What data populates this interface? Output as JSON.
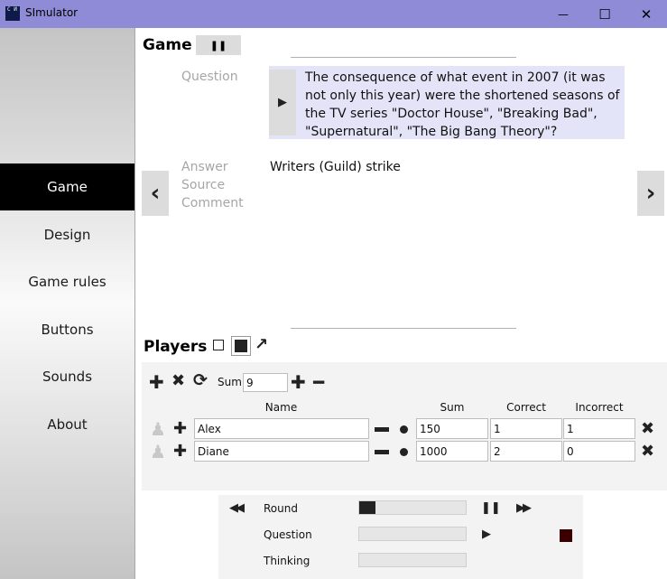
{
  "window": {
    "title": "SImulator",
    "app_icon_glyph": "С И",
    "minimize_glyph": "—",
    "maximize_glyph": "☐",
    "close_glyph": "✕"
  },
  "sidebar": {
    "items": [
      {
        "label": "Game",
        "active": true
      },
      {
        "label": "Design",
        "active": false
      },
      {
        "label": "Game rules",
        "active": false
      },
      {
        "label": "Buttons",
        "active": false
      },
      {
        "label": "Sounds",
        "active": false
      },
      {
        "label": "About",
        "active": false
      }
    ]
  },
  "game": {
    "title": "Game",
    "pause_glyph": "❚❚",
    "question_label": "Question",
    "question_text": "The consequence of what event in 2007 (it was not only this year) were the shortened seasons of the TV series \"Doctor House\", \"Breaking Bad\", \"Supernatural\", \"The Big Bang Theory\"?",
    "play_glyph": "▶",
    "answer_label": "Answer",
    "source_label": "Source",
    "comment_label": "Comment",
    "answer_text": "Writers (Guild) strike",
    "prev_glyph": "‹",
    "next_glyph": "›"
  },
  "players": {
    "title": "Players",
    "toolbar": {
      "add_glyph": "✚",
      "remove_glyph": "✖",
      "refresh_glyph": "⟳",
      "sum_label": "Sum",
      "sum_value": "9",
      "plus_glyph": "✚",
      "minus_glyph": "━"
    },
    "columns": {
      "name": "Name",
      "sum": "Sum",
      "correct": "Correct",
      "incorrect": "Incorrect"
    },
    "rows": [
      {
        "name": "Alex",
        "sum": "150",
        "correct": "1",
        "incorrect": "1"
      },
      {
        "name": "Diane",
        "sum": "1000",
        "correct": "2",
        "incorrect": "0"
      }
    ],
    "pawn_glyph": "♟",
    "delete_glyph": "✖"
  },
  "controls": {
    "rewind_glyph": "◀◀",
    "forward_glyph": "▶▶",
    "pause_glyph": "❚❚",
    "play_glyph": "▶",
    "round_label": "Round",
    "question_label": "Question",
    "thinking_label": "Thinking",
    "round_progress": 0.15,
    "question_progress": 0,
    "thinking_progress": 0,
    "stop_color": "#3a0000"
  },
  "colors": {
    "titlebar": "#8f8bd6",
    "question_bg": "#e4e4f8",
    "active_nav": "#000000"
  }
}
